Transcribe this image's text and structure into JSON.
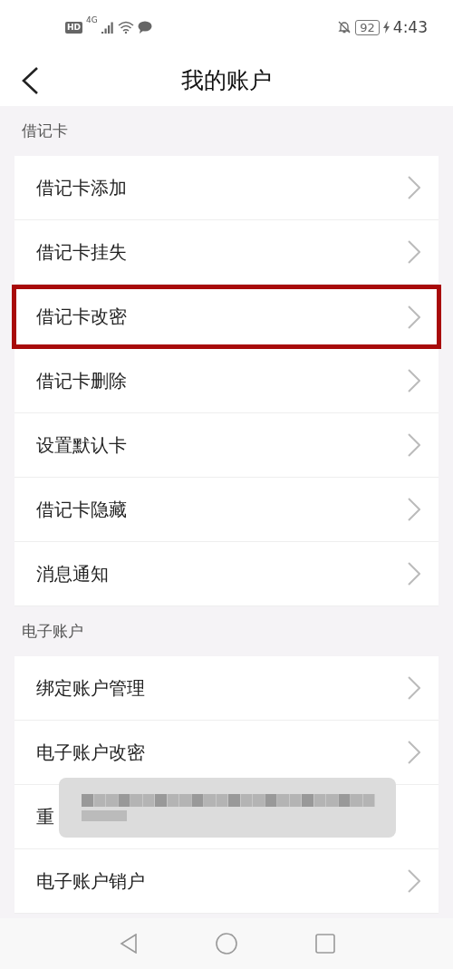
{
  "status_bar": {
    "hd": "HD",
    "network": "4G",
    "battery": "92",
    "time": "4:43"
  },
  "header": {
    "title": "我的账户"
  },
  "sections": [
    {
      "title": "借记卡",
      "items": [
        {
          "label": "借记卡添加",
          "highlighted": false
        },
        {
          "label": "借记卡挂失",
          "highlighted": false
        },
        {
          "label": "借记卡改密",
          "highlighted": true
        },
        {
          "label": "借记卡删除",
          "highlighted": false
        },
        {
          "label": "设置默认卡",
          "highlighted": false
        },
        {
          "label": "借记卡隐藏",
          "highlighted": false
        },
        {
          "label": "消息通知",
          "highlighted": false
        }
      ]
    },
    {
      "title": "电子账户",
      "items": [
        {
          "label": "绑定账户管理",
          "highlighted": false
        },
        {
          "label": "电子账户改密",
          "highlighted": false
        },
        {
          "label": "重",
          "highlighted": false,
          "toast": true
        },
        {
          "label": "电子账户销户",
          "highlighted": false
        }
      ]
    }
  ]
}
